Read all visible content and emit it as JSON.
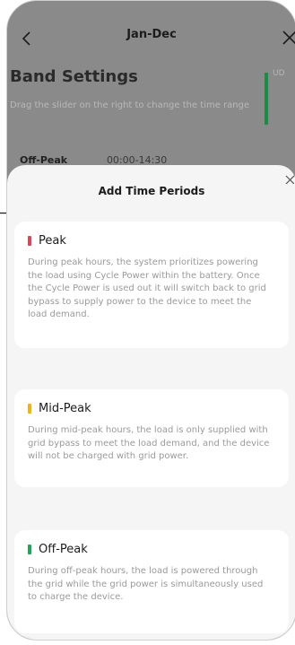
{
  "header": {
    "title": "Jan-Dec"
  },
  "background": {
    "page_title": "Band Settings",
    "description": "Drag the slider on the right to change the time range",
    "first_row_label": "Off-Peak",
    "first_row_time": "00:00-14:30",
    "side_label": "UD",
    "accent_color": "#1f8a48"
  },
  "sheet": {
    "title": "Add Time Periods",
    "cards": [
      {
        "title": "Peak",
        "color": "#e0445a",
        "text": "During peak hours, the system prioritizes powering the load using Cycle Power within the battery. Once the Cycle Power is used out it will switch back to grid bypass to supply power to the device to meet the load demand."
      },
      {
        "title": "Mid-Peak",
        "color": "#f2b01e",
        "text": "During mid-peak hours, the load is only supplied with grid bypass to meet the load demand, and the device will not be charged with grid power."
      },
      {
        "title": "Off-Peak",
        "color": "#22a35a",
        "text": "During off-peak hours, the load is powered through the grid while the grid power is simultaneously used to charge the device."
      }
    ]
  }
}
